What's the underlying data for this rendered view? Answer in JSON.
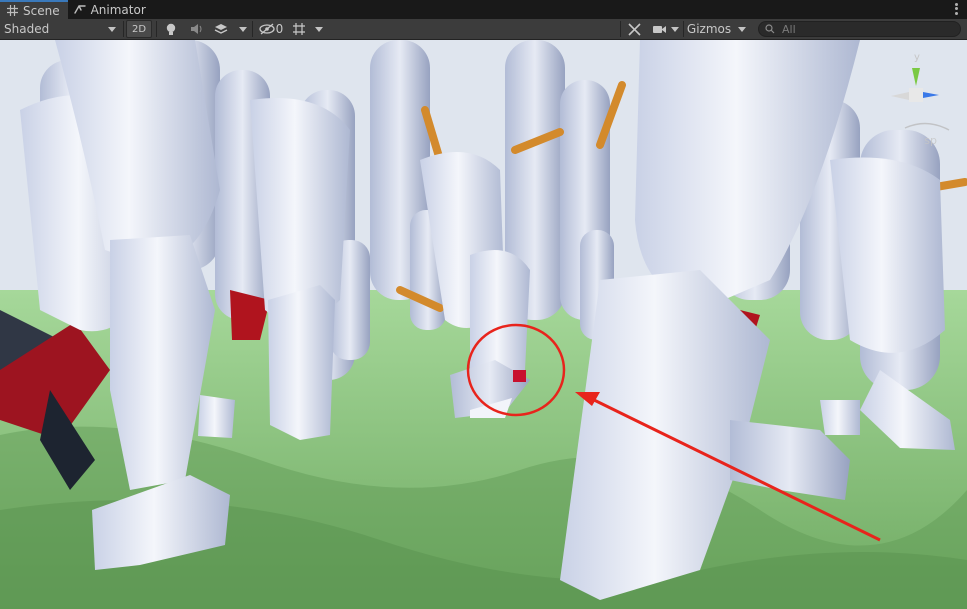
{
  "tabs": [
    {
      "label": "Scene",
      "icon": "grid-icon",
      "active": true
    },
    {
      "label": "Animator",
      "icon": "animator-icon",
      "active": false
    }
  ],
  "toolbar": {
    "draw_mode": "Shaded",
    "mode_2d": "2D",
    "hidden_count": "0",
    "gizmos_label": "Gizmos",
    "search_placeholder": "All"
  },
  "scene_gizmo": {
    "axis_label": "y",
    "projection_label": "sp"
  },
  "colors": {
    "accent": "#3a79bb",
    "annotation": "#e8241c",
    "ground": "#86c57a",
    "character": "#e4e9f4",
    "highlight_box": "#c8102e"
  }
}
